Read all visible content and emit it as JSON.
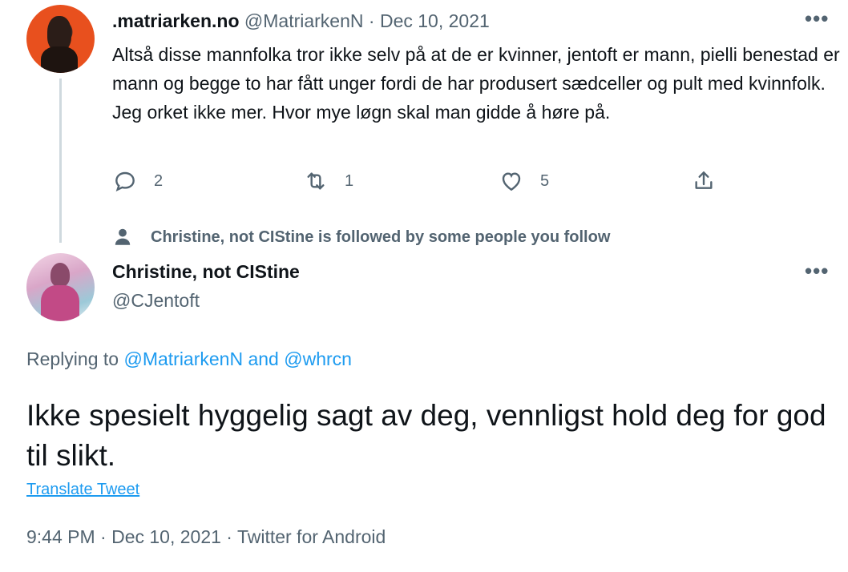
{
  "tweet1": {
    "display_name": ".matriarken.no",
    "handle": "@MatriarkenN",
    "separator": " · ",
    "date": "Dec 10, 2021",
    "text": "Altså disse mannfolka tror ikke selv på at de er kvinner, jentoft er mann, pielli benestad er mann og begge to har fått unger fordi de har produsert sædceller og pult med kvinnfolk. Jeg orket ikke mer. Hvor mye løgn skal man gidde å høre på.",
    "reply_count": "2",
    "retweet_count": "1",
    "like_count": "5",
    "more_label": "•••"
  },
  "social_context": "Christine, not CIStine is followed by some people you follow",
  "tweet2": {
    "display_name": "Christine, not CIStine",
    "handle": "@CJentoft",
    "more_label": "•••",
    "replying_prefix": "Replying to ",
    "replying_user1": "@MatriarkenN",
    "replying_and": " and ",
    "replying_user2": "@whrcn",
    "text": "Ikke spesielt hyggelig sagt av deg, vennligst hold deg for god til slikt.",
    "translate_label": "Translate Tweet",
    "footer": "9:44 PM · Dec 10, 2021 · Twitter for Android"
  },
  "colors": {
    "accent": "#1d9bf0",
    "secondary_text": "#536471",
    "primary_text": "#0f1419"
  },
  "icons": {
    "reply": "comment-bubble-icon",
    "retweet": "retweet-icon",
    "like": "heart-icon",
    "share": "share-icon",
    "social": "person-icon",
    "more": "ellipsis-icon"
  }
}
